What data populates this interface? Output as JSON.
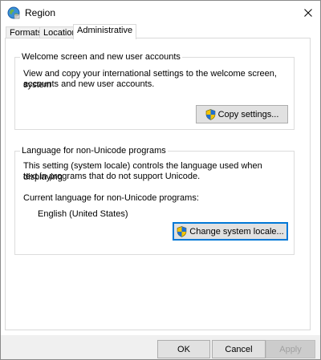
{
  "window": {
    "title": "Region",
    "icon": "globe-icon",
    "close_glyph": "✕"
  },
  "tabs": [
    {
      "label": "Formats",
      "active": false
    },
    {
      "label": "Location",
      "active": false
    },
    {
      "label": "Administrative",
      "active": true
    }
  ],
  "welcome_group": {
    "title": "Welcome screen and new user accounts",
    "description_line1": "View and copy your international settings to the welcome screen, system",
    "description_line2": "accounts and new user accounts.",
    "copy_button_label": "Copy settings...",
    "copy_button_icon": "uac-shield-icon"
  },
  "nonunicode_group": {
    "title": "Language for non-Unicode programs",
    "description_line1": "This setting (system locale) controls the language used when displaying",
    "description_line2": "text in programs that do not support Unicode.",
    "current_label": "Current language for non-Unicode programs:",
    "current_value": "English (United States)",
    "change_button_label": "Change system locale...",
    "change_button_icon": "uac-shield-icon"
  },
  "footer": {
    "ok_label": "OK",
    "cancel_label": "Cancel",
    "apply_label": "Apply"
  },
  "colors": {
    "focus_blue": "#0078d7",
    "button_face": "#e1e1e1",
    "footer_bg": "#f0f0f0"
  }
}
